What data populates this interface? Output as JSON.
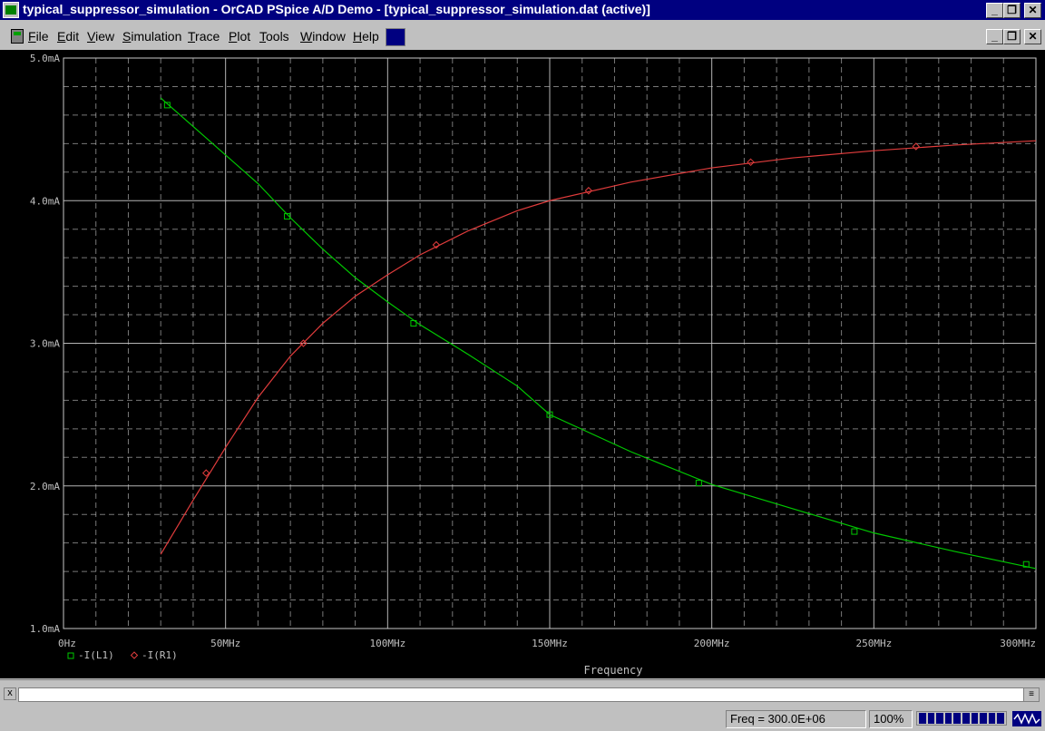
{
  "window": {
    "title": "typical_suppressor_simulation - OrCAD PSpice A/D Demo  - [typical_suppressor_simulation.dat (active)]",
    "minimize_label": "_",
    "restore_label": "❐",
    "close_label": "✕"
  },
  "menu": {
    "items": [
      "File",
      "Edit",
      "View",
      "Simulation",
      "Trace",
      "Plot",
      "Tools",
      "Window",
      "Help"
    ]
  },
  "status": {
    "freq_readout": "Freq = 300.0E+06",
    "zoom": "100%",
    "progress_fraction": 1.0
  },
  "command": {
    "close_label": "x",
    "value": ""
  },
  "colors": {
    "plot_bg": "#000000",
    "grid": "#c8c8c8",
    "series_L1": "#00c800",
    "series_R1": "#e03c3c",
    "axis_text": "#c0c0c0"
  },
  "chart_data": {
    "type": "line",
    "xlabel": "Frequency",
    "xlim": [
      0,
      300
    ],
    "ylim": [
      1.0,
      5.0
    ],
    "x_ticks": [
      "0Hz",
      "50MHz",
      "100MHz",
      "150MHz",
      "200MHz",
      "250MHz",
      "300MHz"
    ],
    "y_ticks": [
      "1.0mA",
      "2.0mA",
      "3.0mA",
      "4.0mA",
      "5.0mA"
    ],
    "grid": true,
    "legend_position": "bottom-left",
    "series": [
      {
        "name": "-I(L1)",
        "marker": "square",
        "x_mhz": [
          30,
          40,
          50,
          60,
          70,
          80,
          90,
          100,
          110,
          125,
          140,
          150,
          175,
          200,
          225,
          250,
          275,
          300
        ],
        "y_ma": [
          4.72,
          4.52,
          4.32,
          4.12,
          3.88,
          3.66,
          3.46,
          3.29,
          3.13,
          2.92,
          2.7,
          2.5,
          2.24,
          2.01,
          1.84,
          1.67,
          1.54,
          1.42
        ],
        "marker_x": [
          32,
          69,
          108,
          150,
          196,
          244,
          297
        ],
        "marker_y": [
          4.67,
          3.89,
          3.14,
          2.5,
          2.02,
          1.68,
          1.45
        ]
      },
      {
        "name": "-I(R1)",
        "marker": "diamond",
        "x_mhz": [
          30,
          40,
          50,
          60,
          70,
          80,
          90,
          100,
          110,
          125,
          140,
          150,
          175,
          200,
          225,
          250,
          275,
          300
        ],
        "y_ma": [
          1.52,
          1.9,
          2.27,
          2.62,
          2.91,
          3.14,
          3.33,
          3.48,
          3.62,
          3.79,
          3.93,
          4.0,
          4.13,
          4.23,
          4.3,
          4.35,
          4.39,
          4.42
        ],
        "marker_x": [
          44,
          74,
          115,
          162,
          212,
          263
        ],
        "marker_y": [
          2.09,
          3.0,
          3.69,
          4.07,
          4.27,
          4.38
        ]
      }
    ]
  }
}
